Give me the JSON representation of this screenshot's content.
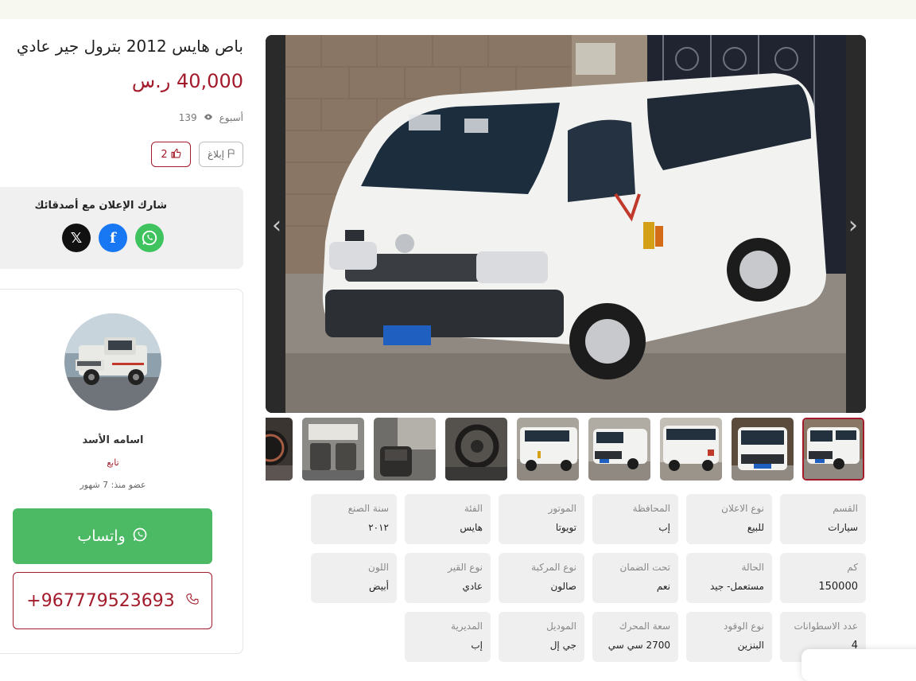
{
  "listing": {
    "title": "باص هايس 2012 بترول جير عادي",
    "price": "40,000 ر.س",
    "posted": "أسبوع",
    "views": "139",
    "report_label": "إبلاغ",
    "likes": "2"
  },
  "share": {
    "title": "شارك الإعلان مع أصدقائك"
  },
  "seller": {
    "name": "اسامه الأسد",
    "follow_label": "تابع",
    "member_since": "عضو منذ: 7 شهور",
    "whatsapp_label": "واتساب",
    "phone": "+967779523693"
  },
  "gallery": {
    "thumbnail_count": 9,
    "active_thumbnail": 9
  },
  "specs": [
    {
      "key": "القسم",
      "value": "سيارات"
    },
    {
      "key": "نوع الاعلان",
      "value": "للبيع"
    },
    {
      "key": "المحافظة",
      "value": "إب"
    },
    {
      "key": "الموتور",
      "value": "تويوتا"
    },
    {
      "key": "الفئة",
      "value": "هايس"
    },
    {
      "key": "سنة الصنع",
      "value": "٢٠١٢"
    },
    {
      "key": "كم",
      "value": "150000"
    },
    {
      "key": "الحالة",
      "value": "مستعمل- جيد"
    },
    {
      "key": "تحت الضمان",
      "value": "نعم"
    },
    {
      "key": "نوع المركبة",
      "value": "صالون"
    },
    {
      "key": "نوع القير",
      "value": "عادي"
    },
    {
      "key": "اللون",
      "value": "أبيض"
    },
    {
      "key": "عدد الاسطوانات",
      "value": "4"
    },
    {
      "key": "نوع الوقود",
      "value": "البنزين"
    },
    {
      "key": "سعة المحرك",
      "value": "2700 سي سي"
    },
    {
      "key": "الموديل",
      "value": "جي إل"
    },
    {
      "key": "المديرية",
      "value": "إب"
    }
  ],
  "colors": {
    "accent": "#a31b2b",
    "whatsapp": "#4cb964",
    "panel": "#efefef"
  }
}
